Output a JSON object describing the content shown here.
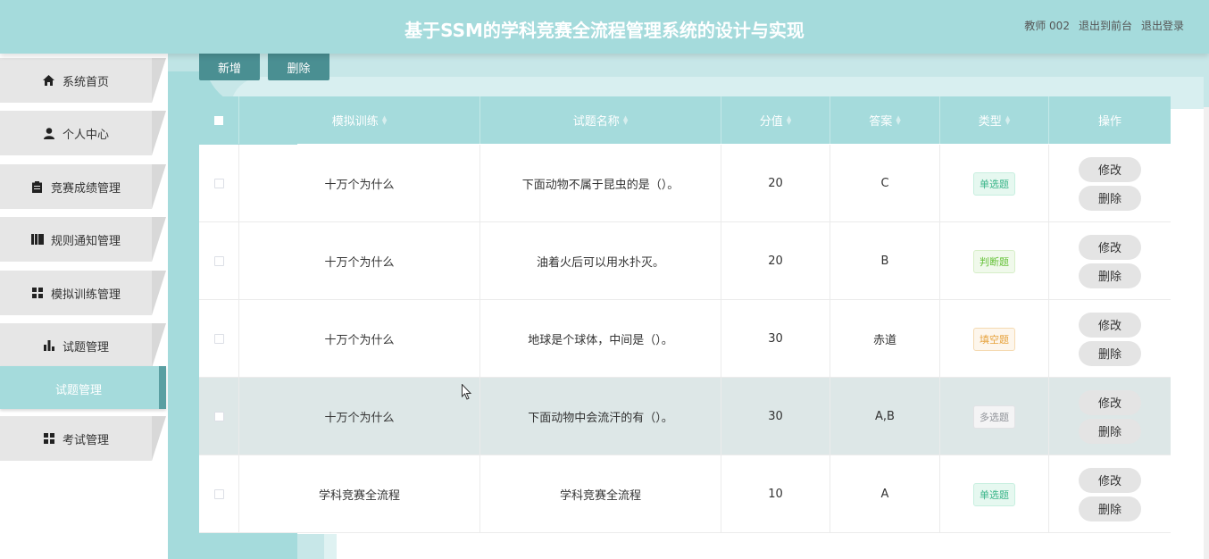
{
  "header": {
    "title": "基于SSM的学科竞赛全流程管理系统的设计与实现",
    "user": "教师 002",
    "back_link": "退出到前台",
    "logout_link": "退出登录"
  },
  "sidebar": {
    "items": [
      {
        "label": "系统首页",
        "icon": "home-icon"
      },
      {
        "label": "个人中心",
        "icon": "user-icon"
      },
      {
        "label": "竞赛成绩管理",
        "icon": "clipboard-icon"
      },
      {
        "label": "规则通知管理",
        "icon": "book-icon"
      },
      {
        "label": "模拟训练管理",
        "icon": "grid-icon"
      },
      {
        "label": "试题管理",
        "icon": "bar-chart-icon"
      },
      {
        "label": "考试管理",
        "icon": "grid-icon"
      }
    ],
    "submenu_active": "试题管理"
  },
  "toolbar": {
    "add_label": "新增",
    "delete_label": "删除"
  },
  "table": {
    "headers": [
      "模拟训练",
      "试题名称",
      "分值",
      "答案",
      "类型",
      "操作"
    ],
    "rows": [
      {
        "training": "十万个为什么",
        "name": "下面动物不属于昆虫的是（）。",
        "score": "20",
        "answer": "C",
        "type": "单选题",
        "edit": "修改",
        "delete": "删除"
      },
      {
        "training": "十万个为什么",
        "name": "油着火后可以用水扑灭。",
        "score": "20",
        "answer": "B",
        "type": "判断题",
        "edit": "修改",
        "delete": "删除"
      },
      {
        "training": "十万个为什么",
        "name": "地球是个球体，中间是（）。",
        "score": "30",
        "answer": "赤道",
        "type": "填空题",
        "edit": "修改",
        "delete": "删除"
      },
      {
        "training": "十万个为什么",
        "name": "下面动物中会流汗的有（）。",
        "score": "30",
        "answer": "A,B",
        "type": "多选题",
        "edit": "修改",
        "delete": "删除"
      },
      {
        "training": "学科竞赛全流程",
        "name": "学科竞赛全流程",
        "score": "10",
        "answer": "A",
        "type": "单选题",
        "edit": "修改",
        "delete": "删除"
      }
    ]
  },
  "colors": {
    "header_bg": "#a5dbdc",
    "button_bg": "#4a8f92",
    "hover_row": "#dde7e7"
  }
}
